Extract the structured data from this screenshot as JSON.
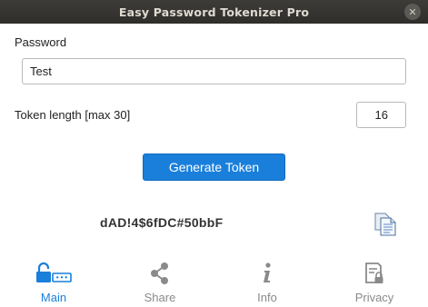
{
  "window": {
    "title": "Easy Password Tokenizer Pro",
    "close_glyph": "✕"
  },
  "form": {
    "password_label": "Password",
    "password_value": "Test",
    "length_label": "Token length [max 30]",
    "length_value": "16"
  },
  "actions": {
    "generate_label": "Generate Token"
  },
  "result": {
    "token": "dAD!4$6fDC#50bbF",
    "copy_icon": "copy-icon"
  },
  "tabs": [
    {
      "label": "Main",
      "icon": "lock-password-icon",
      "active": true
    },
    {
      "label": "Share",
      "icon": "share-icon",
      "active": false
    },
    {
      "label": "Info",
      "icon": "info-icon",
      "active": false
    },
    {
      "label": "Privacy",
      "icon": "privacy-document-icon",
      "active": false
    }
  ],
  "colors": {
    "accent": "#1a7fdb",
    "inactive": "#8a8a8a",
    "titlebar": "#3a3935"
  }
}
